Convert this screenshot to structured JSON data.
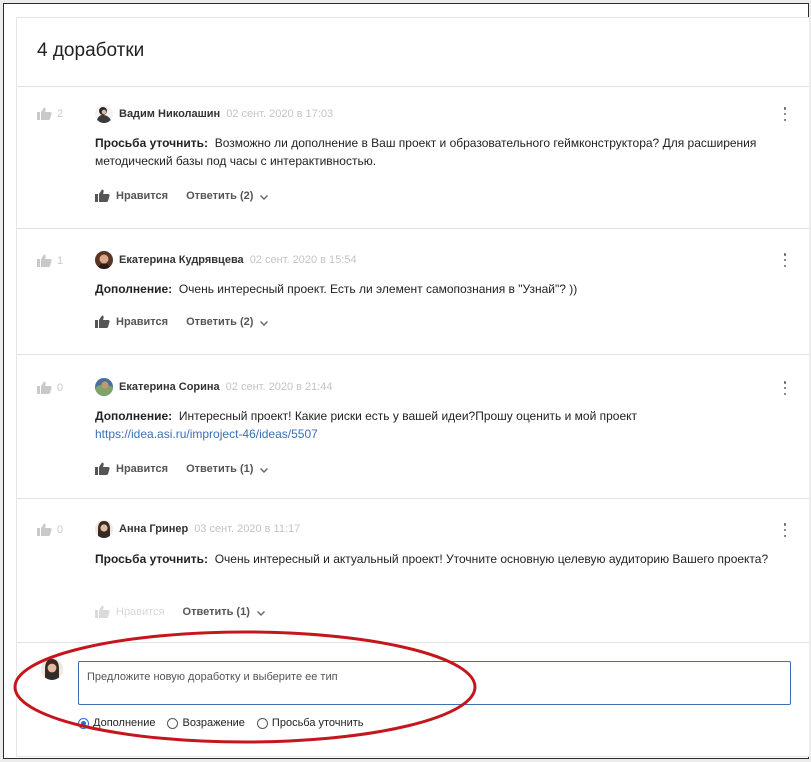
{
  "title": "4 доработки",
  "like_label": "Нравится",
  "comments": [
    {
      "likes": "2",
      "author": "Вадим Николашин",
      "date": "02 сент. 2020 в 17:03",
      "type": "Просьба уточнить:",
      "text": "Возможно ли дополнение в Ваш проект и образовательного геймконструктора? Для расширения методический базы под часы с интерактивностью.",
      "link": "",
      "reply": "Ответить (2)"
    },
    {
      "likes": "1",
      "author": "Екатерина Кудрявцева",
      "date": "02 сент. 2020 в 15:54",
      "type": "Дополнение:",
      "text": "Очень интересный проект. Есть ли элемент самопознания в \"Узнай\"? ))",
      "link": "",
      "reply": "Ответить (2)"
    },
    {
      "likes": "0",
      "author": "Екатерина Сорина",
      "date": "02 сент. 2020 в 21:44",
      "type": "Дополнение:",
      "text": "Интересный проект! Какие риски есть у вашей идеи?Прошу оценить и мой проект",
      "link": "https://idea.asi.ru/improject-46/ideas/5507",
      "reply": "Ответить (1)"
    },
    {
      "likes": "0",
      "author": "Анна Гринер",
      "date": "03 сент. 2020 в 11:17",
      "type": "Просьба уточнить:",
      "text": "Очень интересный и актуальный проект! Уточните основную целевую аудиторию Вашего проекта?",
      "link": "",
      "reply": "Ответить (1)"
    }
  ],
  "new_comment": {
    "placeholder": "Предложите новую доработку и выберите ее тип",
    "types": [
      "Дополнение",
      "Возражение",
      "Просьба уточнить"
    ],
    "selected": "Дополнение"
  },
  "colors": {
    "accent": "#2b68c9",
    "link": "#3c6fb5",
    "annotation_circle": "#c4161c"
  }
}
